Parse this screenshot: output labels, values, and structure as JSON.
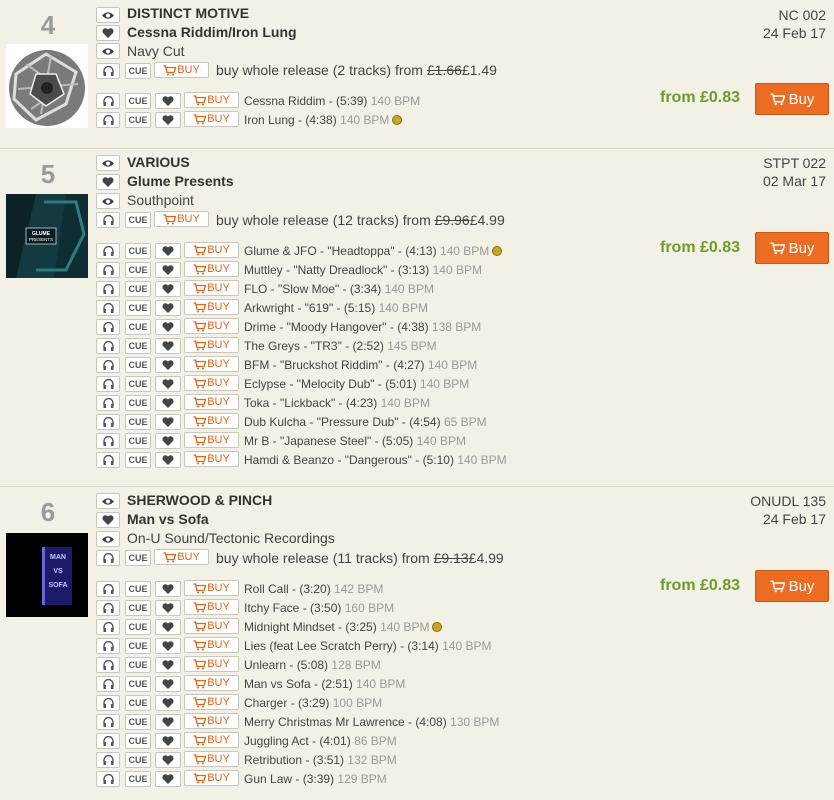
{
  "releases": [
    {
      "rank": "4",
      "artist": "DISTINCT MOTIVE",
      "title": "Cessna Riddim/Iron Lung",
      "label": "Navy Cut",
      "catno": "NC 002",
      "date": "24 Feb 17",
      "whole_prefix": "buy whole release (2 tracks) from",
      "old_price": "£1.66",
      "new_price": "£1.49",
      "from_price": "from £0.83",
      "buy_label": "Buy",
      "tracks": [
        {
          "name": "Cessna Riddim - (5:39)",
          "bpm": "140 BPM",
          "disc": false
        },
        {
          "name": "Iron Lung - (4:38)",
          "bpm": "140 BPM",
          "disc": true
        }
      ]
    },
    {
      "rank": "5",
      "artist": "VARIOUS",
      "title": "Glume Presents",
      "label": "Southpoint",
      "catno": "STPT 022",
      "date": "02 Mar 17",
      "whole_prefix": "buy whole release (12 tracks) from",
      "old_price": "£9.96",
      "new_price": "£4.99",
      "from_price": "from £0.83",
      "buy_label": "Buy",
      "tracks": [
        {
          "name": "Glume & JFO - \"Headtoppa\" - (4:13)",
          "bpm": "140 BPM",
          "disc": true
        },
        {
          "name": "Muttley - \"Natty Dreadlock\" - (3:13)",
          "bpm": "140 BPM",
          "disc": false
        },
        {
          "name": "FLO - \"Slow Moe\" - (3:34)",
          "bpm": "140 BPM",
          "disc": false
        },
        {
          "name": "Arkwright - \"619\" - (5:15)",
          "bpm": "140 BPM",
          "disc": false
        },
        {
          "name": "Drime - \"Moody Hangover\" - (4:38)",
          "bpm": "138 BPM",
          "disc": false
        },
        {
          "name": "The Greys - \"TR3\" - (2:52)",
          "bpm": "145 BPM",
          "disc": false
        },
        {
          "name": "BFM - \"Bruckshot Riddim\" - (4:27)",
          "bpm": "140 BPM",
          "disc": false
        },
        {
          "name": "Eclypse - \"Melocity Dub\" - (5:01)",
          "bpm": "140 BPM",
          "disc": false
        },
        {
          "name": "Toka - \"Lickback\" - (4:23)",
          "bpm": "140 BPM",
          "disc": false
        },
        {
          "name": "Dub Kulcha - \"Pressure Dub\" - (4:54)",
          "bpm": "65 BPM",
          "disc": false
        },
        {
          "name": "Mr B - \"Japanese Steel\" - (5:05)",
          "bpm": "140 BPM",
          "disc": false
        },
        {
          "name": "Hamdi & Beanzo - \"Dangerous\" - (5:10)",
          "bpm": "140 BPM",
          "disc": false
        }
      ]
    },
    {
      "rank": "6",
      "artist": "SHERWOOD & PINCH",
      "title": "Man vs Sofa",
      "label": "On-U Sound/Tectonic Recordings",
      "catno": "ONUDL 135",
      "date": "24 Feb 17",
      "whole_prefix": "buy whole release (11 tracks) from",
      "old_price": "£9.13",
      "new_price": "£4.99",
      "from_price": "from £0.83",
      "buy_label": "Buy",
      "tracks": [
        {
          "name": "Roll Call - (3:20)",
          "bpm": "142 BPM",
          "disc": false
        },
        {
          "name": "Itchy Face - (3:50)",
          "bpm": "160 BPM",
          "disc": false
        },
        {
          "name": "Midnight Mindset - (3:25)",
          "bpm": "140 BPM",
          "disc": true
        },
        {
          "name": "Lies (feat Lee Scratch Perry) - (3:14)",
          "bpm": "140 BPM",
          "disc": false
        },
        {
          "name": "Unlearn - (5:08)",
          "bpm": "128 BPM",
          "disc": false
        },
        {
          "name": "Man vs Sofa - (2:51)",
          "bpm": "140 BPM",
          "disc": false
        },
        {
          "name": "Charger - (3:29)",
          "bpm": "100 BPM",
          "disc": false
        },
        {
          "name": "Merry Christmas Mr Lawrence - (4:08)",
          "bpm": "130 BPM",
          "disc": false
        },
        {
          "name": "Juggling Act - (4:01)",
          "bpm": "86 BPM",
          "disc": false
        },
        {
          "name": "Retribution - (3:51)",
          "bpm": "132 BPM",
          "disc": false
        },
        {
          "name": "Gun Law - (3:39)",
          "bpm": "129 BPM",
          "disc": false
        }
      ]
    }
  ],
  "ui": {
    "cue_label": "CUE",
    "small_buy_label": "BUY"
  },
  "colors": {
    "accent_orange": "#ec6c24",
    "price_green": "#6e9b2a",
    "background": "#f3f1e6"
  },
  "icons": [
    "eye-icon",
    "heart-icon",
    "headphones-icon",
    "cart-icon",
    "vinyl-disc-icon"
  ]
}
